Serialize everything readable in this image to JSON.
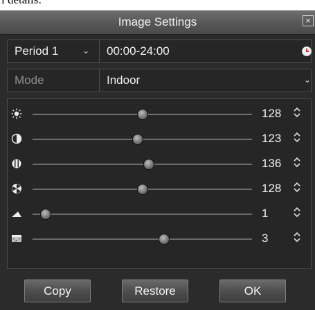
{
  "page_caption_fragment": "l details:",
  "dialog": {
    "title": "Image Settings",
    "close_icon": "close-icon"
  },
  "schedule": {
    "period_label": "Period 1",
    "period_chevron": "⌄",
    "time_range": "00:00-24:00",
    "clock_icon": "clock-icon"
  },
  "mode": {
    "label": "Mode",
    "value": "Indoor",
    "chevron": "⌄"
  },
  "sliders": [
    {
      "name": "brightness",
      "icon": "brightness-icon",
      "value": "128",
      "level": 0.5,
      "spinner": "⇕"
    },
    {
      "name": "contrast",
      "icon": "contrast-icon",
      "value": "123",
      "level": 0.48,
      "spinner": "⇕"
    },
    {
      "name": "saturation",
      "icon": "saturation-icon",
      "value": "136",
      "level": 0.53,
      "spinner": "⇕"
    },
    {
      "name": "hue",
      "icon": "hue-icon",
      "value": "128",
      "level": 0.5,
      "spinner": "⇕"
    },
    {
      "name": "sharpness",
      "icon": "sharpness-icon",
      "value": "1",
      "level": 0.06,
      "spinner": "⇕"
    },
    {
      "name": "denoising",
      "icon": "denoising-icon",
      "value": "3",
      "level": 0.6,
      "spinner": "⇕"
    }
  ],
  "buttons": {
    "copy": "Copy",
    "restore": "Restore",
    "ok": "OK"
  },
  "colors": {
    "dialog_bg": "#2b2b2b",
    "panel_bg": "#262626",
    "border": "#4d4d4d",
    "text": "#f0f0f0",
    "clock_hand": "#c0392b"
  }
}
